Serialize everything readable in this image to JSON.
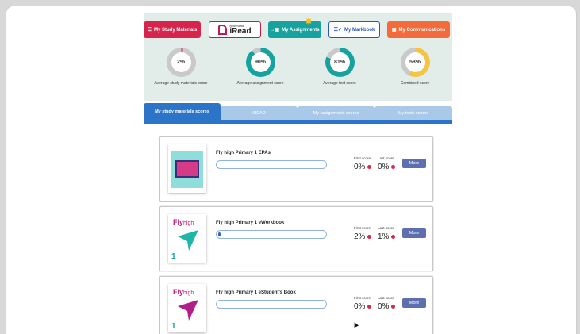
{
  "nav": {
    "study": "My Study Materials",
    "iread_small": "Richmond",
    "iread_big": "iRead",
    "assignments": "My Assignments",
    "markbook": "My Markbook",
    "communications": "My Communications"
  },
  "gauges": [
    {
      "value": "2%",
      "label": "Average study materials score",
      "fraction": 0.02,
      "color": "#d6244d"
    },
    {
      "value": "90%",
      "label": "Average assignment score",
      "fraction": 0.9,
      "color": "#17a2a0"
    },
    {
      "value": "81%",
      "label": "Average test score",
      "fraction": 0.81,
      "color": "#17a2a0"
    },
    {
      "value": "58%",
      "label": "Combined score",
      "fraction": 0.58,
      "color": "#f4c542"
    }
  ],
  "tabs": [
    "My study materials scores",
    "iREAD",
    "My assignments scores",
    "My tests scores"
  ],
  "score_labels": {
    "first": "First score",
    "last": "Last score"
  },
  "more_label": "More",
  "logo": {
    "fly": "Fly",
    "high": "high",
    "level": "1"
  },
  "cards": [
    {
      "title": "Fly high Primary 1 EPAs",
      "progress": 0,
      "first": "0%",
      "last": "0%"
    },
    {
      "title": "Fly high Primary 1 eWorkbook",
      "progress": 0.01,
      "first": "2%",
      "last": "1%"
    },
    {
      "title": "Fly high Primary 1 eStudent's Book",
      "progress": 0,
      "first": "0%",
      "last": "0%"
    }
  ],
  "colors": {
    "accent": "#2c74c7",
    "dot": "#d9284f",
    "more": "#5e6fb0"
  }
}
